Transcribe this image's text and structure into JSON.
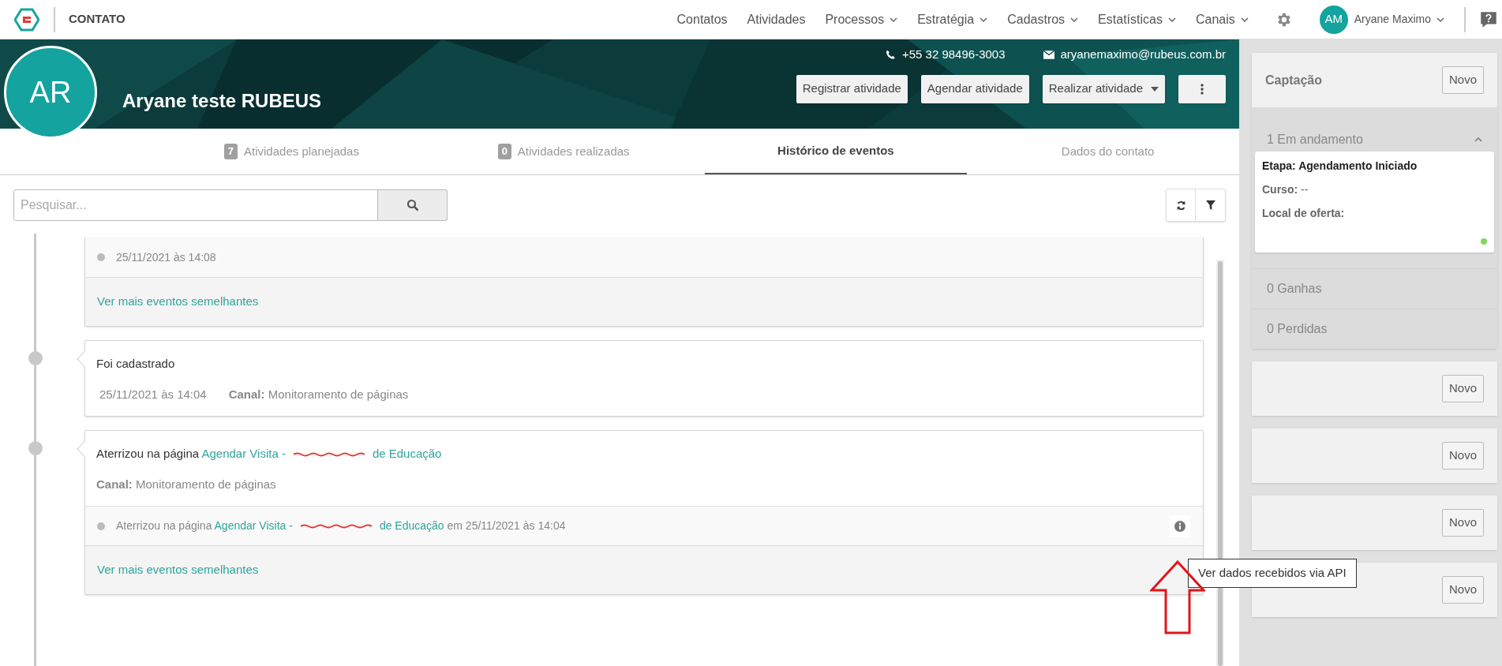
{
  "app": {
    "section_title": "CONTATO"
  },
  "nav": [
    {
      "label": "Contatos",
      "dropdown": false
    },
    {
      "label": "Atividades",
      "dropdown": false
    },
    {
      "label": "Processos",
      "dropdown": true
    },
    {
      "label": "Estratégia",
      "dropdown": true
    },
    {
      "label": "Cadastros",
      "dropdown": true
    },
    {
      "label": "Estatísticas",
      "dropdown": true
    },
    {
      "label": "Canais",
      "dropdown": true
    }
  ],
  "user": {
    "initials": "AM",
    "name": "Aryane Maximo"
  },
  "contact": {
    "initials": "AR",
    "name": "Aryane teste RUBEUS",
    "phone": "+55 32 98496-3003",
    "email": "aryanemaximo@rubeus.com.br"
  },
  "actions": [
    {
      "kind": "button",
      "label": "Registrar atividade"
    },
    {
      "kind": "button",
      "label": "Agendar atividade"
    },
    {
      "kind": "dropdown",
      "label": "Realizar atividade"
    },
    {
      "kind": "more"
    }
  ],
  "tabs": [
    {
      "count": "7",
      "label": "Atividades planejadas",
      "selected": false
    },
    {
      "count": "0",
      "label": "Atividades realizadas",
      "selected": false
    },
    {
      "label": "Histórico de eventos",
      "selected": true
    },
    {
      "label": "Dados do contato",
      "selected": false
    }
  ],
  "search": {
    "placeholder": "Pesquisar..."
  },
  "events": [
    {
      "cut_top": true,
      "timeline_dot": false,
      "history": [
        {
          "segments": [
            {
              "kind": "text",
              "text": "25/11/2021 às 14:08"
            }
          ],
          "info": false
        }
      ],
      "more_link": "Ver mais eventos semelhantes"
    },
    {
      "cut_top": false,
      "timeline_dot": true,
      "title": [
        {
          "kind": "text",
          "text": "Foi cadastrado"
        }
      ],
      "date": "25/11/2021 às 14:04",
      "channel": "**Canal:** Monitoramento de páginas"
    },
    {
      "cut_top": false,
      "timeline_dot": true,
      "title": [
        {
          "kind": "text",
          "text": "Aterrizou na página "
        },
        {
          "kind": "link",
          "text": "Agendar Visita -"
        },
        {
          "kind": "redacted"
        },
        {
          "kind": "link",
          "text": "de Educação"
        }
      ],
      "channel": "**Canal:** Monitoramento de páginas",
      "history": [
        {
          "segments": [
            {
              "kind": "text",
              "text": "Aterrizou na página "
            },
            {
              "kind": "link",
              "text": "Agendar Visita -"
            },
            {
              "kind": "redacted"
            },
            {
              "kind": "link",
              "text": "de Educação"
            },
            {
              "kind": "text",
              "text": " em 25/11/2021 às 14:04"
            }
          ],
          "info": true
        }
      ],
      "more_link": "Ver mais eventos semelhantes"
    }
  ],
  "tooltip": {
    "text": "Ver dados recebidos via API"
  },
  "pipelines": [
    {
      "title": "Captação",
      "button": "Novo",
      "stages": [
        {
          "label": "1 Em andamento",
          "expanded": true,
          "cards": [
            {
              "lines": [
                {
                  "kind": "stage",
                  "text": "Etapa: Agendamento Iniciado"
                },
                {
                  "kind": "field",
                  "text": "**Curso:** --"
                },
                {
                  "kind": "field",
                  "text": "**Local de oferta:**"
                }
              ],
              "color": "#7ed957"
            }
          ]
        },
        {
          "label": "0 Ganhas",
          "expanded": false
        },
        {
          "label": "0 Perdidas",
          "expanded": false
        }
      ]
    },
    {
      "button": "Novo"
    },
    {
      "button": "Novo"
    },
    {
      "button": "Novo"
    },
    {
      "button": "Novo"
    }
  ]
}
